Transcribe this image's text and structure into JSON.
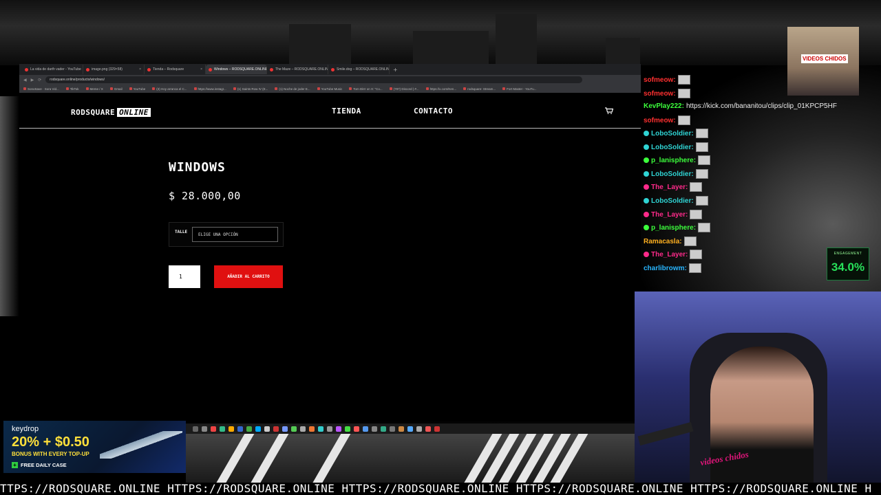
{
  "browser": {
    "tabs": [
      {
        "label": "La vida de darth vader - YouTube",
        "active": false
      },
      {
        "label": "image.png (329×58)",
        "active": false
      },
      {
        "label": "Tienda – Rodsquare",
        "active": false
      },
      {
        "label": "Windows – RODSQUARE.ONLINE",
        "active": true
      },
      {
        "label": "The Maze – RODSQUARE.ONLINE",
        "active": false
      },
      {
        "label": "Smile.dog – RODSQUARE.ONLINE",
        "active": false
      }
    ],
    "url": "rodsquare.online/products/windows/",
    "bookmarks": [
      "SonoSave · Sora Vid...",
      "TikTok",
      "Meme / X",
      "Gmail",
      "YouTube",
      "(3) Hoy arranca el C...",
      "https://www.instagr...",
      "(1) Saints Row IV (E...",
      "(1) Noche de joder E...",
      "YouTube Music",
      "Tom DiIrr on X: \"Co...",
      "(787) Discord | #...",
      "https://x.com/Ken...",
      "rodsquare: Stream...",
      "Fort Master - YouTu..."
    ]
  },
  "site": {
    "logo_main": "RODSQUARE",
    "logo_accent": "ONLINE",
    "nav": [
      "TIENDA",
      "CONTACTO"
    ],
    "product_title": "WINDOWS",
    "price": "$ 28.000,00",
    "variation_label": "TALLE",
    "variation_placeholder": "ELIGE UNA OPCIÓN",
    "quantity": "1",
    "add_to_cart": "AÑADIR AL CARRITO"
  },
  "chat": [
    {
      "user": "sofmeow:",
      "color": "#ff3030",
      "badge": false,
      "msg": ""
    },
    {
      "user": "sofmeow:",
      "color": "#ff3030",
      "badge": false,
      "msg": ""
    },
    {
      "user": "KevPlay222:",
      "color": "#3cff3c",
      "badge": false,
      "msg": "https://kick.com/bananitou/clips/clip_01KPCP5HF"
    },
    {
      "user": "sofmeow:",
      "color": "#ff3030",
      "badge": false,
      "msg": ""
    },
    {
      "user": "LoboSoldier:",
      "color": "#2fd4d4",
      "badge": true,
      "msg": ""
    },
    {
      "user": "LoboSoldier:",
      "color": "#2fd4d4",
      "badge": true,
      "msg": ""
    },
    {
      "user": "p_lanisphere:",
      "color": "#3cff3c",
      "badge": true,
      "msg": ""
    },
    {
      "user": "LoboSoldier:",
      "color": "#2fd4d4",
      "badge": true,
      "msg": ""
    },
    {
      "user": "The_Layer:",
      "color": "#ff2a8a",
      "badge": true,
      "msg": ""
    },
    {
      "user": "LoboSoldier:",
      "color": "#2fd4d4",
      "badge": true,
      "msg": ""
    },
    {
      "user": "The_Layer:",
      "color": "#ff2a8a",
      "badge": true,
      "msg": ""
    },
    {
      "user": "p_lanisphere:",
      "color": "#3cff3c",
      "badge": true,
      "msg": ""
    },
    {
      "user": "Ramacasla:",
      "color": "#ffb020",
      "badge": false,
      "msg": ""
    },
    {
      "user": "The_Layer:",
      "color": "#ff2a8a",
      "badge": true,
      "msg": ""
    },
    {
      "user": "charlibrowm:",
      "color": "#29b6ff",
      "badge": false,
      "msg": ""
    }
  ],
  "webcam_top_label": "VIDEOS CHIDOS",
  "engagement": {
    "label": "ENGAGEMENT",
    "value": "34.0%"
  },
  "keydrop": {
    "brand": "keydrop",
    "promo": "20% + $0.50",
    "promo2": "BONUS WITH EVERY TOP-UP",
    "daily": "FREE DAILY CASE"
  },
  "webcam_stamp": "videos chidos",
  "ticker": "TTPS://RODSQUARE.ONLINE HTTPS://RODSQUARE.ONLINE HTTPS://RODSQUARE.ONLINE HTTPS://RODSQUARE.ONLINE HTTPS://RODSQUARE.ONLINE H"
}
